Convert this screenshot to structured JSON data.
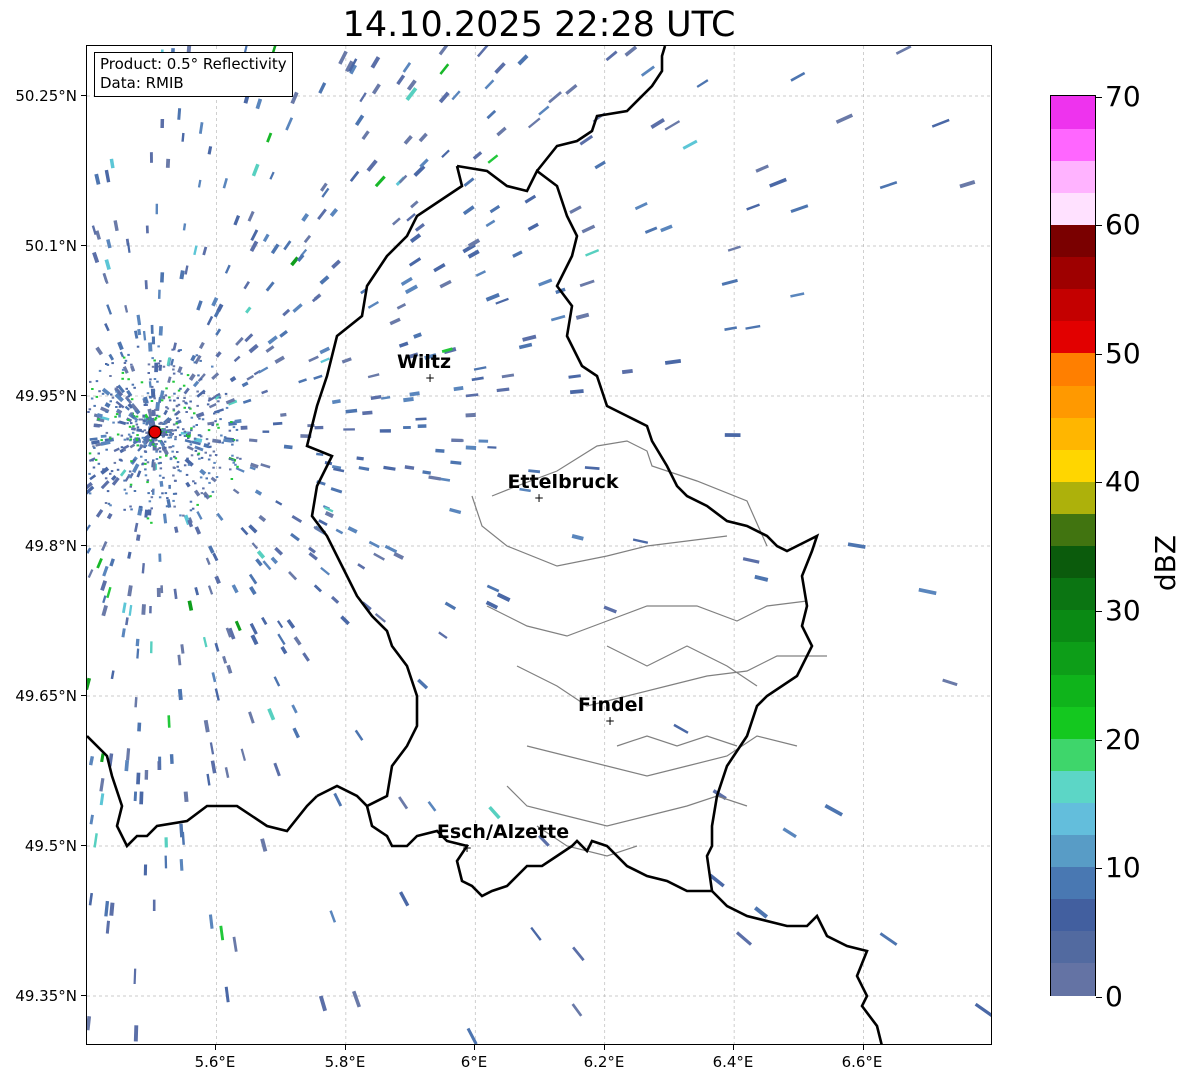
{
  "title": "14.10.2025 22:28 UTC",
  "info": {
    "product": "Product: 0.5° Reflectivity",
    "data": "Data: RMIB"
  },
  "axes": {
    "lat_labels": [
      "50.25°N",
      "50.1°N",
      "49.95°N",
      "49.8°N",
      "49.65°N",
      "49.5°N",
      "49.35°N"
    ],
    "lon_labels": [
      "5.6°E",
      "5.8°E",
      "6°E",
      "6.2°E",
      "6.4°E",
      "6.6°E"
    ],
    "lat_values": [
      50.25,
      50.1,
      49.95,
      49.8,
      49.65,
      49.5,
      49.35
    ],
    "lon_values": [
      5.6,
      5.8,
      6.0,
      6.2,
      6.4,
      6.6
    ],
    "lon_range": [
      5.4,
      6.8
    ],
    "lat_range": [
      49.3,
      50.3
    ],
    "grid": true
  },
  "colorbar": {
    "unit": "dBZ",
    "labels": [
      "70",
      "60",
      "50",
      "40",
      "30",
      "20",
      "10",
      "0"
    ],
    "min": 0,
    "max": 70,
    "colors": [
      "#6473a4",
      "#526aa0",
      "#425f9f",
      "#4978b2",
      "#589cc6",
      "#63bedc",
      "#5cd6c6",
      "#3ed66b",
      "#14c81f",
      "#0fb41b",
      "#0d9e18",
      "#0a8a14",
      "#0b7512",
      "#0b5b0c",
      "#417410",
      "#adb10b",
      "#ffd600",
      "#ffb600",
      "#ff9900",
      "#ff7f00",
      "#e20000",
      "#c40000",
      "#9e0000",
      "#7a0000",
      "#ffe1ff",
      "#ffb3ff",
      "#ff66ff",
      "#ee33ee"
    ]
  },
  "cities": [
    {
      "name": "Wiltz",
      "lon": 5.93,
      "lat": 49.967
    },
    {
      "name": "Ettelbruck",
      "lon": 6.1,
      "lat": 49.848
    },
    {
      "name": "Findel",
      "lon": 6.21,
      "lat": 49.626
    },
    {
      "name": "Esch/Alzette",
      "lon": 5.99,
      "lat": 49.497
    }
  ],
  "radar_site": {
    "lon": 5.505,
    "lat": 49.914
  }
}
